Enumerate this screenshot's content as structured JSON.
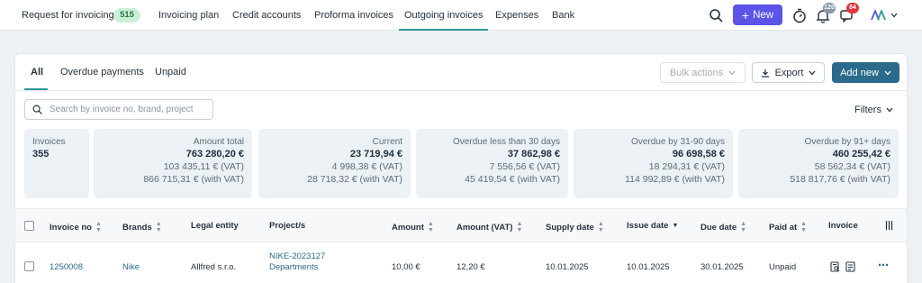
{
  "nav": {
    "items": [
      {
        "label": "Request for invoicing",
        "badge": "515"
      },
      {
        "label": "Invoicing plan"
      },
      {
        "label": "Credit accounts"
      },
      {
        "label": "Proforma invoices"
      },
      {
        "label": "Outgoing invoices",
        "active": true
      },
      {
        "label": "Expenses"
      },
      {
        "label": "Bank"
      }
    ],
    "new_label": "New",
    "notifications_count": "120",
    "messages_count": "84",
    "account_logo": "AA"
  },
  "tabs": [
    {
      "label": "All",
      "active": true
    },
    {
      "label": "Overdue payments"
    },
    {
      "label": "Unpaid"
    }
  ],
  "actions": {
    "bulk_label": "Bulk actions",
    "export_label": "Export",
    "add_label": "Add new"
  },
  "search": {
    "placeholder": "Search by invoice no, brand, project",
    "value": ""
  },
  "filters_label": "Filters",
  "stats": [
    {
      "label": "Invoices",
      "value": "355"
    },
    {
      "label": "Amount total",
      "value": "763 280,20 €",
      "vat": "103 435,11 € (VAT)",
      "with_vat": "866 715,31 € (with VAT)"
    },
    {
      "label": "Current",
      "value": "23 719,94 €",
      "vat": "4 998,38 € (VAT)",
      "with_vat": "28 718,32 € (with VAT)"
    },
    {
      "label": "Overdue less than 30 days",
      "value": "37 862,98 €",
      "vat": "7 556,56 € (VAT)",
      "with_vat": "45 419,54 € (with VAT)"
    },
    {
      "label": "Overdue by 31-90 days",
      "value": "96 698,58 €",
      "vat": "18 294,31 € (VAT)",
      "with_vat": "114 992,89 € (with VAT)"
    },
    {
      "label": "Overdue by 91+ days",
      "value": "460 255,42 €",
      "vat": "58 562,34 € (VAT)",
      "with_vat": "518 817,76 € (with VAT)"
    }
  ],
  "table": {
    "columns": [
      "Invoice no",
      "Brands",
      "Legal entity",
      "Project/s",
      "Amount",
      "Amount (VAT)",
      "Supply date",
      "Issue date",
      "Due date",
      "Paid at",
      "Invoice"
    ],
    "rows": [
      {
        "invoice_no": "1250008",
        "brand": "Nike",
        "legal_entity": "Allfred s.r.o.",
        "project_line1": "NIKE-2023127",
        "project_line2": "Departments",
        "amount": "10,00 €",
        "amount_vat": "12,20 €",
        "supply_date": "10.01.2025",
        "issue_date": "10.01.2025",
        "due_date": "30.01.2025",
        "paid_at": "Unpaid"
      }
    ]
  },
  "colors": {
    "accent": "#2d9c94",
    "new_button": "#5b54e6",
    "add_button": "#2b6a8a",
    "link": "#2b6a8a"
  }
}
